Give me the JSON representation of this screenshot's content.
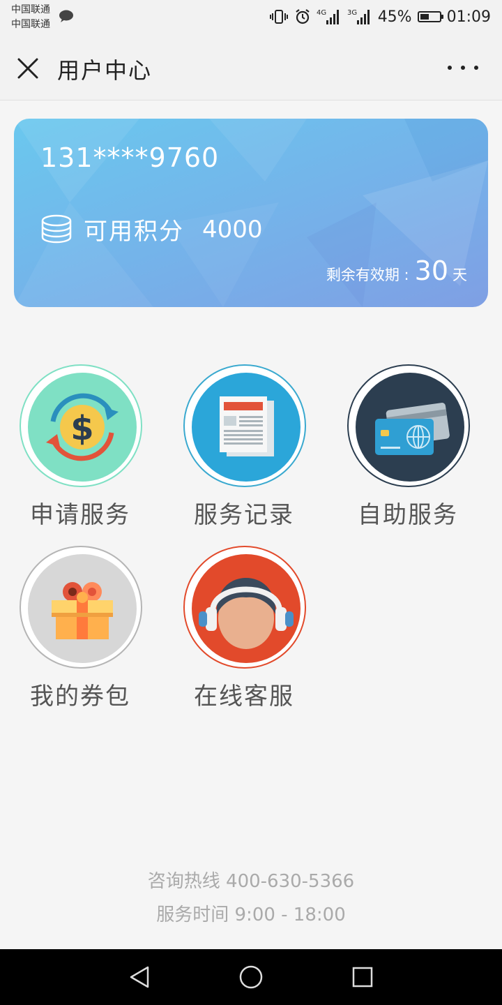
{
  "status_bar": {
    "carrier_1": "中国联通",
    "carrier_2": "中国联通",
    "network_1": "4G",
    "network_2": "3G",
    "battery": "45%",
    "time": "01:09"
  },
  "header": {
    "title": "用户中心"
  },
  "card": {
    "phone": "131****9760",
    "points_label": "可用积分",
    "points_value": "4000",
    "validity_label": "剩余有效期 :",
    "validity_days": "30",
    "validity_unit": "天"
  },
  "services": [
    {
      "label": "申请服务",
      "icon": "dollar-exchange-icon"
    },
    {
      "label": "服务记录",
      "icon": "newspaper-icon"
    },
    {
      "label": "自助服务",
      "icon": "credit-card-icon"
    },
    {
      "label": "我的券包",
      "icon": "gift-box-icon"
    },
    {
      "label": "在线客服",
      "icon": "customer-service-icon"
    }
  ],
  "footer": {
    "hotline": "咨询热线 400-630-5366",
    "service_time": "服务时间 9:00 - 18:00"
  },
  "colors": {
    "card_gradient_start": "#6ac8ee",
    "card_gradient_end": "#7f9fe4",
    "apply_bg": "#7fe0c4",
    "record_bg": "#2ba6d9",
    "self_bg": "#2c3e50",
    "coupon_bg": "#d7d7d7",
    "support_bg": "#e24a2b"
  }
}
